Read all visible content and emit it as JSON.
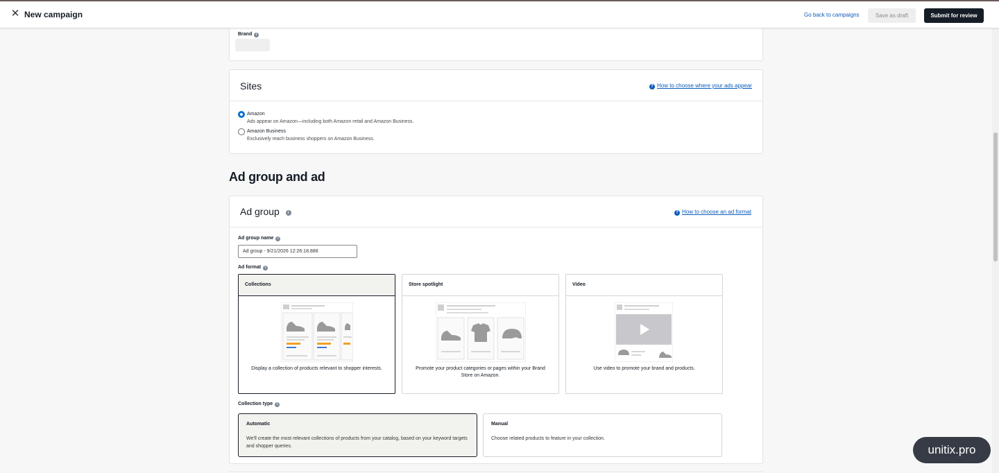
{
  "header": {
    "close_icon": "close-icon",
    "title": "New campaign",
    "back_link": "Go back to campaigns",
    "save_draft": "Save as draft",
    "submit": "Submit for review"
  },
  "brand": {
    "label": "Brand"
  },
  "sites": {
    "title": "Sites",
    "help_link": "How to choose where your ads appear",
    "options": [
      {
        "label": "Amazon",
        "desc": "Ads appear on Amazon—including both Amazon retail and Amazon Business.",
        "checked": true
      },
      {
        "label": "Amazon Business",
        "desc": "Exclusively reach business shoppers on Amazon Business.",
        "checked": false
      }
    ]
  },
  "ad_section": {
    "heading": "Ad group and ad"
  },
  "ad_group": {
    "title": "Ad group",
    "help_link": "How to choose an ad format",
    "name_label": "Ad group name",
    "name_value": "Ad group - 9/21/2026 12:26:18.888",
    "format_label": "Ad format",
    "formats": [
      {
        "name": "Collections",
        "desc": "Display a collection of products relevant to shopper interests.",
        "selected": true
      },
      {
        "name": "Store spotlight",
        "desc": "Promote your product categories or pages within your Brand Store on Amazon.",
        "selected": false
      },
      {
        "name": "Video",
        "desc": "Use video to promote your brand and products.",
        "selected": false
      }
    ],
    "collection_type_label": "Collection type",
    "collection_types": [
      {
        "name": "Automatic",
        "desc": "We'll create the most relevant collections of products from your catalog, based on your keyword targets and shopper queries.",
        "selected": true
      },
      {
        "name": "Manual",
        "desc": "Choose related products to feature in your collection.",
        "selected": false
      }
    ]
  },
  "watermark": "unitix.pro",
  "colors": {
    "accent": "#0a5cba",
    "primary_button": "#161d26",
    "radio_selected": "#0a6fd3"
  }
}
